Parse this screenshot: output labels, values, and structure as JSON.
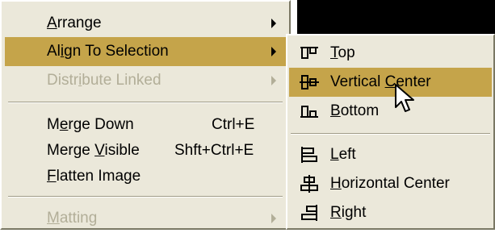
{
  "main_menu": {
    "items": [
      {
        "pre": "",
        "u": "A",
        "post": "rrange",
        "shortcut": ""
      },
      {
        "pre": "Al",
        "u": "i",
        "post": "gn To Selection",
        "shortcut": ""
      },
      {
        "pre": "Distr",
        "u": "i",
        "post": "bute Linked",
        "shortcut": ""
      },
      {
        "pre": "M",
        "u": "e",
        "post": "rge Down",
        "shortcut": "Ctrl+E"
      },
      {
        "pre": "Merge ",
        "u": "V",
        "post": "isible",
        "shortcut": "Shft+Ctrl+E"
      },
      {
        "pre": "",
        "u": "F",
        "post": "latten Image",
        "shortcut": ""
      },
      {
        "pre": "",
        "u": "M",
        "post": "atting",
        "shortcut": ""
      }
    ]
  },
  "submenu": {
    "items": [
      {
        "pre": "",
        "u": "T",
        "post": "op",
        "icon": "align-top-icon"
      },
      {
        "pre": "Vertical ",
        "u": "C",
        "post": "enter",
        "icon": "align-vertical-center-icon"
      },
      {
        "pre": "",
        "u": "B",
        "post": "ottom",
        "icon": "align-bottom-icon"
      },
      {
        "pre": "",
        "u": "L",
        "post": "eft",
        "icon": "align-left-icon"
      },
      {
        "pre": "",
        "u": "H",
        "post": "orizontal Center",
        "icon": "align-horizontal-center-icon"
      },
      {
        "pre": "",
        "u": "R",
        "post": "ight",
        "icon": "align-right-icon"
      }
    ]
  },
  "colors": {
    "menu_bg": "#ebe8da",
    "highlight": "#c5a44a",
    "disabled_text": "#b2ae98"
  }
}
